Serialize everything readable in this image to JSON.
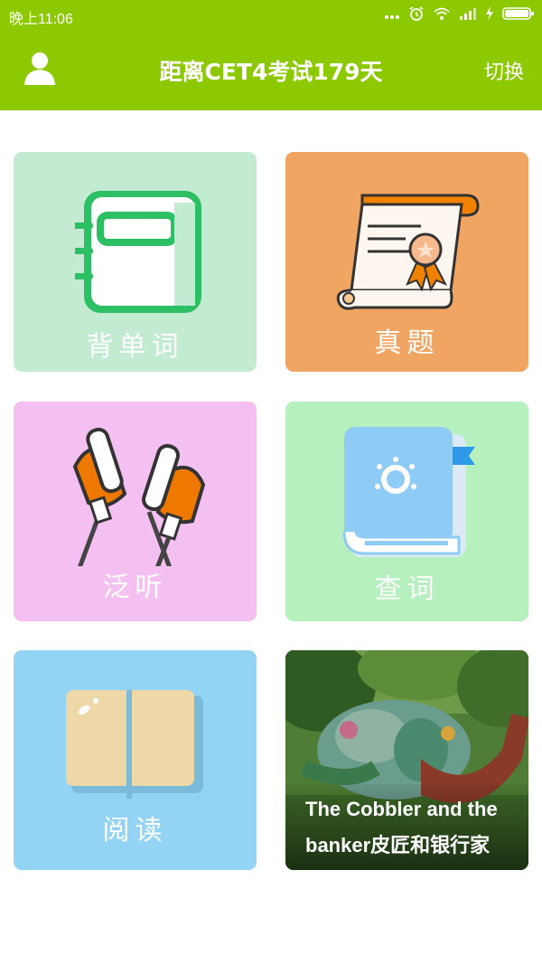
{
  "status_bar": {
    "time": "晚上11:06",
    "icons": [
      "more-dots-icon",
      "alarm-icon",
      "wifi-icon",
      "signal-icon",
      "charging-icon",
      "battery-icon"
    ]
  },
  "app_bar": {
    "title": "距离CET4考试179天",
    "switch_label": "切换",
    "accent_color": "#8cc900"
  },
  "tiles": [
    {
      "label": "背单词",
      "icon": "notebook-icon",
      "bg": "#c3ebd1"
    },
    {
      "label": "真题",
      "icon": "certificate-scroll-icon",
      "bg": "#f0a563"
    },
    {
      "label": "泛听",
      "icon": "earphones-icon",
      "bg": "#f3c0f1"
    },
    {
      "label": "查词",
      "icon": "dictionary-book-icon",
      "bg": "#b7f0bf"
    },
    {
      "label": "阅读",
      "icon": "open-book-icon",
      "bg": "#93d4f4"
    }
  ],
  "article_card": {
    "caption_line1": "The Cobbler and the",
    "caption_line2": "banker皮匠和银行家"
  }
}
